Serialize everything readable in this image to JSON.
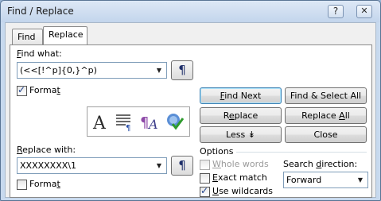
{
  "window": {
    "title": "Find / Replace",
    "help_button": "?",
    "close_button": "✕"
  },
  "tabs": [
    {
      "label": "Find"
    },
    {
      "label": "Replace"
    }
  ],
  "find": {
    "label": "Find what:",
    "value": "(<<[!^p]{0,}^p)",
    "special_button": "¶",
    "format_label": "Format",
    "format_checked": true
  },
  "replace": {
    "label": "Replace with:",
    "value": "XXXXXXXX\\1",
    "special_button": "¶",
    "format_label": "Format",
    "format_checked": false
  },
  "buttons": {
    "find_next": "Find Next",
    "find_select_all": "Find & Select All",
    "replace": "Replace",
    "replace_all": "Replace All",
    "less": "Less ↡",
    "close": "Close"
  },
  "options": {
    "title": "Options",
    "whole_words": "Whole words",
    "exact_match": "Exact match",
    "use_wildcards": "Use wildcards",
    "search_direction_label": "Search direction:",
    "search_direction_value": "Forward"
  },
  "format_icons": [
    {
      "name": "font-icon"
    },
    {
      "name": "paragraph-icon"
    },
    {
      "name": "style-icon"
    },
    {
      "name": "highlight-icon"
    }
  ]
}
